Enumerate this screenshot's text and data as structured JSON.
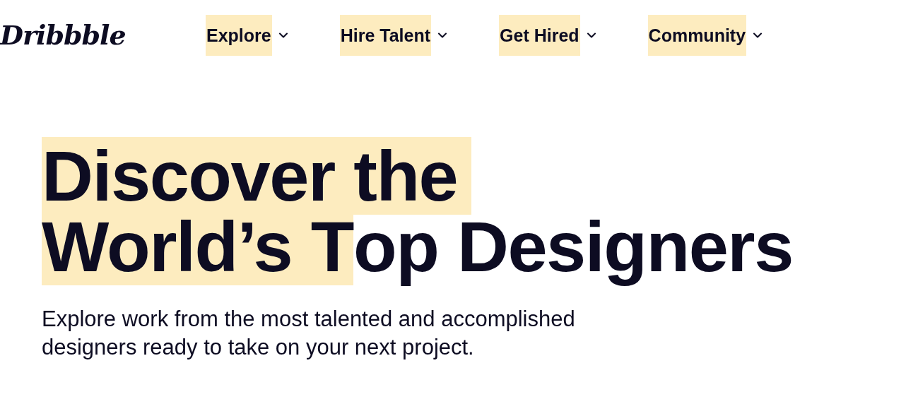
{
  "logo": {
    "text": "Dribbble"
  },
  "nav": [
    {
      "label": "Explore",
      "highlighted": true
    },
    {
      "label": "Hire Talent",
      "highlighted": true
    },
    {
      "label": "Get Hired",
      "highlighted": true
    },
    {
      "label": "Community",
      "highlighted": true
    }
  ],
  "hero": {
    "heading": [
      [
        {
          "text": "Discover the",
          "highlighted": true
        }
      ],
      [
        {
          "text": "World’s T",
          "highlighted": true
        },
        {
          "text": "op Designers",
          "highlighted": false
        }
      ]
    ],
    "subtitle": "Explore work from the most talented and accomplished designers ready to take on your next project."
  }
}
